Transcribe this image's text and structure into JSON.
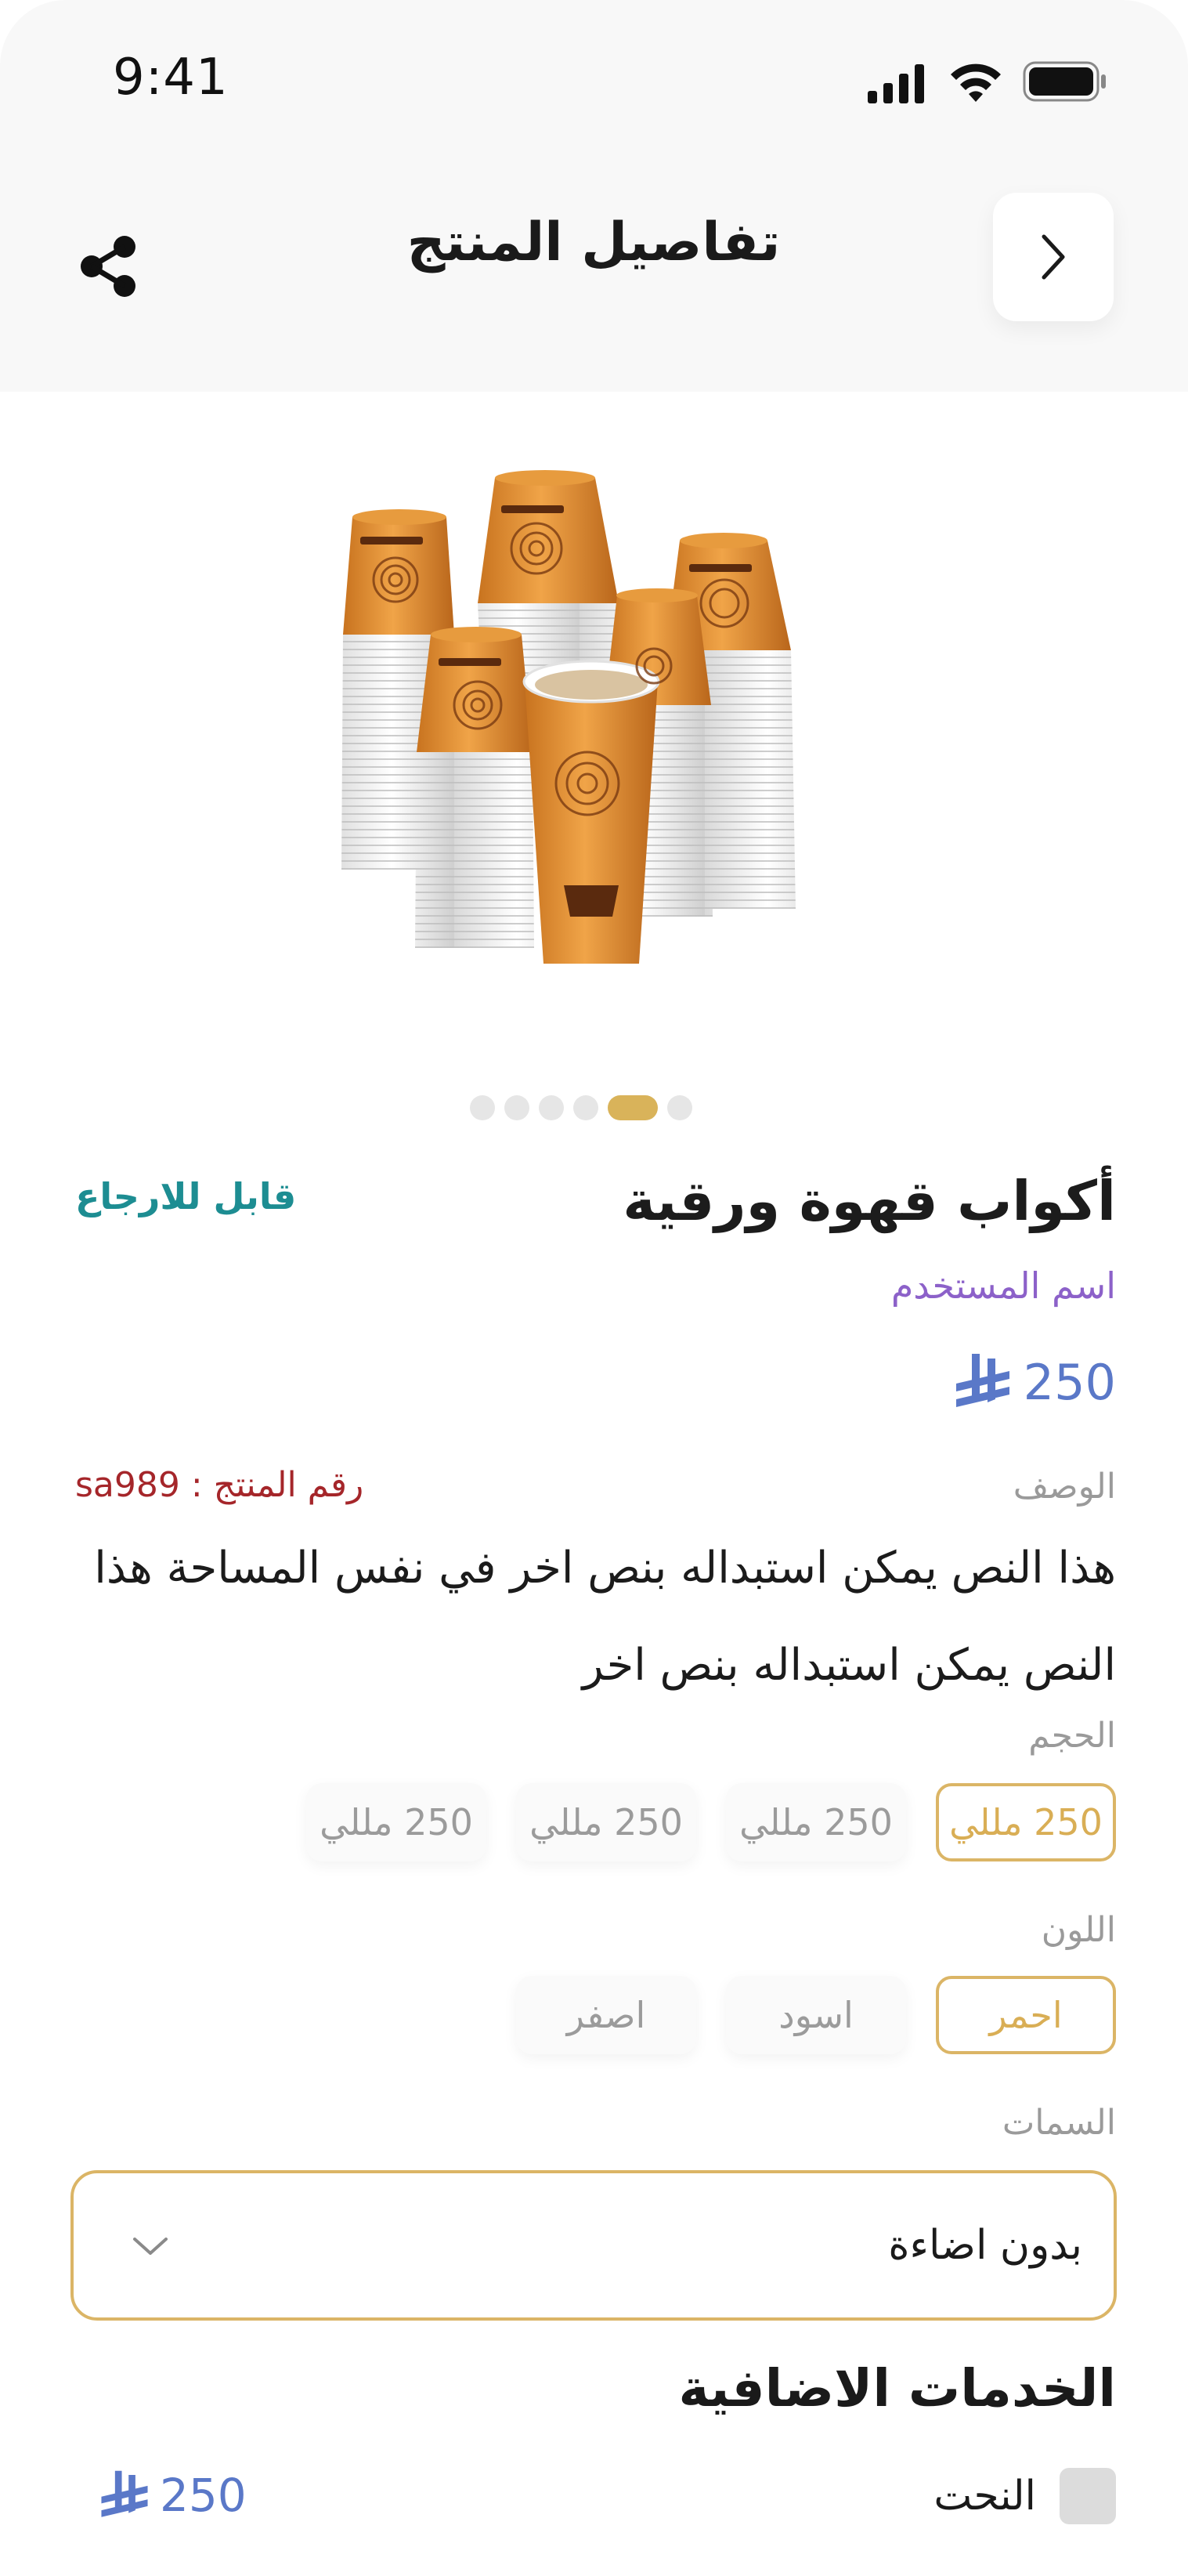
{
  "status_bar": {
    "time": "9:41"
  },
  "header": {
    "title": "تفاصيل المنتج"
  },
  "carousel": {
    "count": 6,
    "active_index": 4
  },
  "product": {
    "name": "أكواب قهوة ورقية",
    "return_badge": "قابل للارجاع",
    "username": "اسم المستخدم",
    "price": "250",
    "description_label": "الوصف",
    "product_code": "رقم المنتج : sa989",
    "description": "هذا النص يمكن استبداله بنص اخر في نفس المساحة هذا النص يمكن استبداله بنص اخر"
  },
  "size": {
    "label": "الحجم",
    "options": [
      "250 مللي",
      "250 مللي",
      "250 مللي",
      "250 مللي"
    ],
    "selected_index": 0
  },
  "color": {
    "label": "اللون",
    "options": [
      "احمر",
      "اسود",
      "اصفر"
    ],
    "selected_index": 0
  },
  "features": {
    "label": "السمات",
    "selected": "بدون اضاءة"
  },
  "additional_services": {
    "title": "الخدمات الاضافية",
    "items": [
      {
        "name": "النحت",
        "price": "250",
        "checked": false
      }
    ]
  },
  "colors": {
    "accent": "#dbb566",
    "price": "#5a78c8",
    "return": "#1d8d92",
    "username": "#8c61c9",
    "code": "#a5262a"
  }
}
